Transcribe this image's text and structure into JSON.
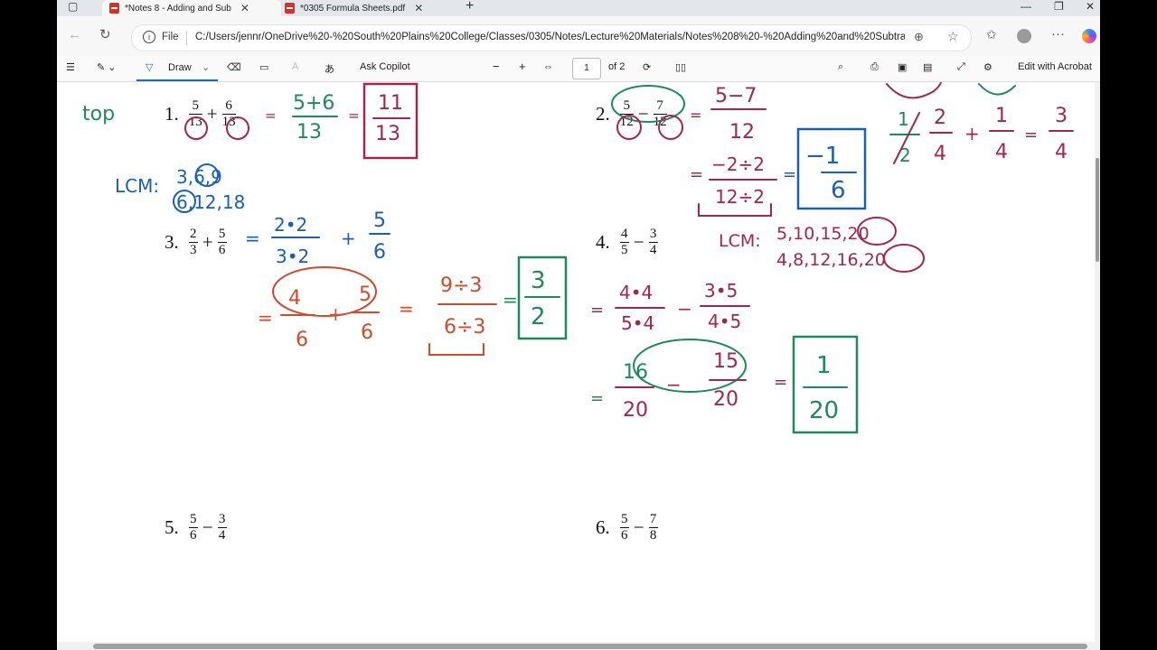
{
  "tabs": [
    {
      "title": "*Notes 8 - Adding and Sub"
    },
    {
      "title": "*0305 Formula Sheets.pdf"
    }
  ],
  "address": {
    "prefix": "File",
    "url": "C:/Users/jennr/OneDrive%20-%20South%20Plains%20College/Classes/0305/Notes/Lecture%20Materials/Notes%208%20-%20Adding%20and%20Subtract..."
  },
  "toolbar": {
    "draw_label": "Draw",
    "copilot_label": "Ask Copilot",
    "page_value": "1",
    "page_total": "of 2",
    "edit_label": "Edit with Acrobat"
  },
  "problems": [
    {
      "num": "1.",
      "a": "5",
      "b": "13",
      "op": "+",
      "c": "6",
      "d": "13"
    },
    {
      "num": "2.",
      "a": "5",
      "b": "12",
      "op": "−",
      "c": "7",
      "d": "12"
    },
    {
      "num": "3.",
      "a": "2",
      "b": "3",
      "op": "+",
      "c": "5",
      "d": "6"
    },
    {
      "num": "4.",
      "a": "4",
      "b": "5",
      "op": "−",
      "c": "3",
      "d": "4"
    },
    {
      "num": "5.",
      "a": "5",
      "b": "6",
      "op": "−",
      "c": "3",
      "d": "4"
    },
    {
      "num": "6.",
      "a": "5",
      "b": "6",
      "op": "−",
      "c": "7",
      "d": "8"
    }
  ],
  "ink": {
    "top_left": "top",
    "lcm_label": "LCM:",
    "lcm3": "3,6,9",
    "lcm6": "6,12,18",
    "lcm4_label": "LCM:",
    "lcm5": "5,10,15,20",
    "lcm4": "4,8,12,16,20",
    "p1_sum": "5+6",
    "p1_den": "13",
    "p1_ans_n": "11",
    "p1_ans_d": "13",
    "p2_diff": "5−7",
    "p2_den": "12",
    "p2_red_n": "−2÷2",
    "p2_red_d": "12÷2",
    "p2_ans_n": "−1",
    "p2_ans_d": "6",
    "p3_a": "2•2",
    "p3_b": "3•2",
    "p3_c": "5",
    "p3_d": "6",
    "p3_e": "4",
    "p3_f": "6",
    "p3_g": "5",
    "p3_h": "6",
    "p3_i": "9÷3",
    "p3_j": "6÷3",
    "p3_ans_n": "3",
    "p3_ans_d": "2",
    "p4_a": "4•4",
    "p4_b": "5•4",
    "p4_c": "3•5",
    "p4_d": "4•5",
    "p4_e": "16",
    "p4_f": "20",
    "p4_g": "15",
    "p4_h": "20",
    "p4_ans_n": "1",
    "p4_ans_d": "20",
    "tr_a": "1",
    "tr_b": "2",
    "tr_c": "2",
    "tr_d": "4",
    "tr_e": "1",
    "tr_f": "4",
    "tr_g": "3",
    "tr_h": "4"
  }
}
